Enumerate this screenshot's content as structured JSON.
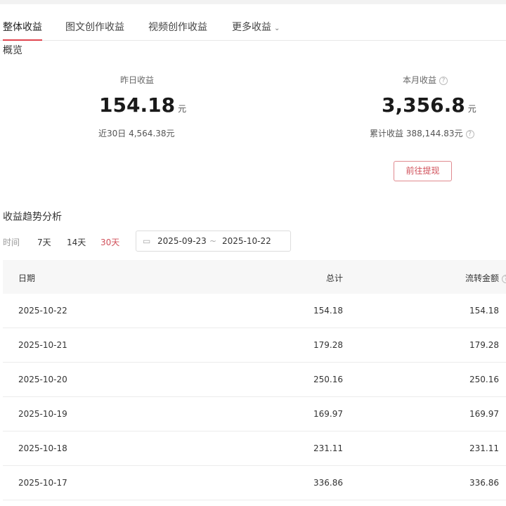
{
  "tabs": [
    "整体收益",
    "图文创作收益",
    "视频创作收益",
    "更多收益"
  ],
  "overview": {
    "title": "概览",
    "yesterday": {
      "label": "昨日收益",
      "value": "154.18",
      "unit": "元",
      "sub": "近30日 4,564.38元"
    },
    "month": {
      "label": "本月收益",
      "value": "3,356.8",
      "unit": "元",
      "sub": "累计收益 388,144.83元"
    },
    "withdraw_label": "前往提现"
  },
  "trend": {
    "title": "收益趋势分析",
    "time_label": "时间",
    "ranges": [
      "7天",
      "14天",
      "30天"
    ],
    "active_range": "30天",
    "start_date": "2025-09-23",
    "sep": "~",
    "end_date": "2025-10-22"
  },
  "table": {
    "headers": [
      "日期",
      "总计",
      "流转金额"
    ],
    "rows": [
      [
        "2025-10-22",
        "154.18",
        "154.18"
      ],
      [
        "2025-10-21",
        "179.28",
        "179.28"
      ],
      [
        "2025-10-20",
        "250.16",
        "250.16"
      ],
      [
        "2025-10-19",
        "169.97",
        "169.97"
      ],
      [
        "2025-10-18",
        "231.11",
        "231.11"
      ],
      [
        "2025-10-17",
        "336.86",
        "336.86"
      ]
    ]
  },
  "colors": {
    "accent": "#e0454f"
  }
}
